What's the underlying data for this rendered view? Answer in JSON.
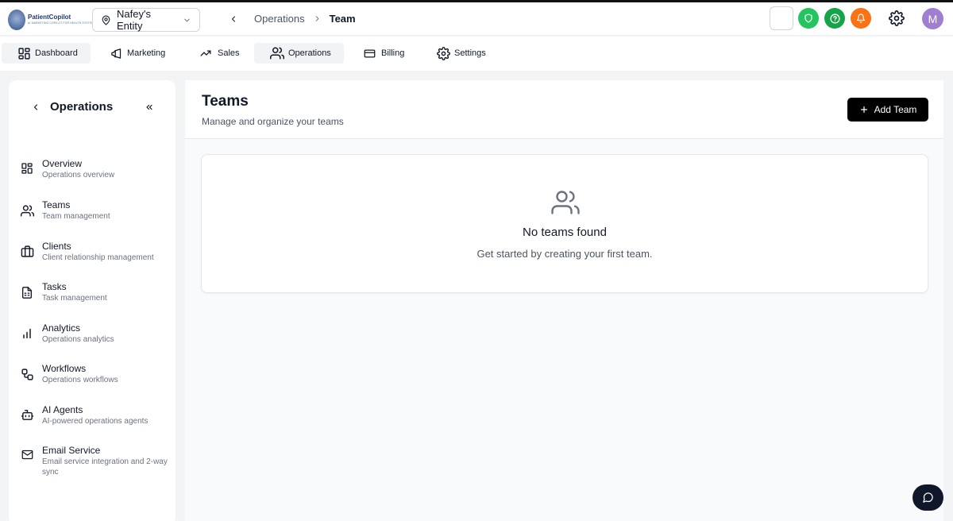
{
  "header": {
    "logo_name": "PatientCopilot",
    "logo_sub": "AI MARKETING COPILOT FOR HEALTH SYSTEMS",
    "entity_name": "Nafey's Entity",
    "breadcrumb": {
      "parent": "Operations",
      "current": "Team"
    },
    "avatar_initial": "M",
    "status_colors": {
      "shield": "#22c55e",
      "help": "#16a34a",
      "bell": "#f97316"
    }
  },
  "nav": {
    "items": [
      {
        "label": "Dashboard",
        "icon": "grid-icon",
        "active": true
      },
      {
        "label": "Marketing",
        "icon": "megaphone-icon",
        "active": false
      },
      {
        "label": "Sales",
        "icon": "trending-up-icon",
        "active": false
      },
      {
        "label": "Operations",
        "icon": "users-icon",
        "active": true
      },
      {
        "label": "Billing",
        "icon": "credit-card-icon",
        "active": false
      },
      {
        "label": "Settings",
        "icon": "gear-icon",
        "active": false
      }
    ]
  },
  "sidebar": {
    "title": "Operations",
    "items": [
      {
        "label": "Overview",
        "desc": "Operations overview",
        "icon": "grid-icon"
      },
      {
        "label": "Teams",
        "desc": "Team management",
        "icon": "users-icon"
      },
      {
        "label": "Clients",
        "desc": "Client relationship management",
        "icon": "briefcase-icon"
      },
      {
        "label": "Tasks",
        "desc": "Task management",
        "icon": "file-spreadsheet-icon"
      },
      {
        "label": "Analytics",
        "desc": "Operations analytics",
        "icon": "bar-chart-icon"
      },
      {
        "label": "Workflows",
        "desc": "Operations workflows",
        "icon": "workflow-icon"
      },
      {
        "label": "AI Agents",
        "desc": "AI-powered operations agents",
        "icon": "bot-icon"
      },
      {
        "label": "Email Service",
        "desc": "Email service integration and 2-way sync",
        "icon": "mail-icon"
      }
    ]
  },
  "main": {
    "title": "Teams",
    "subtitle": "Manage and organize your teams",
    "add_button": "Add Team",
    "empty_title": "No teams found",
    "empty_sub": "Get started by creating your first team."
  }
}
